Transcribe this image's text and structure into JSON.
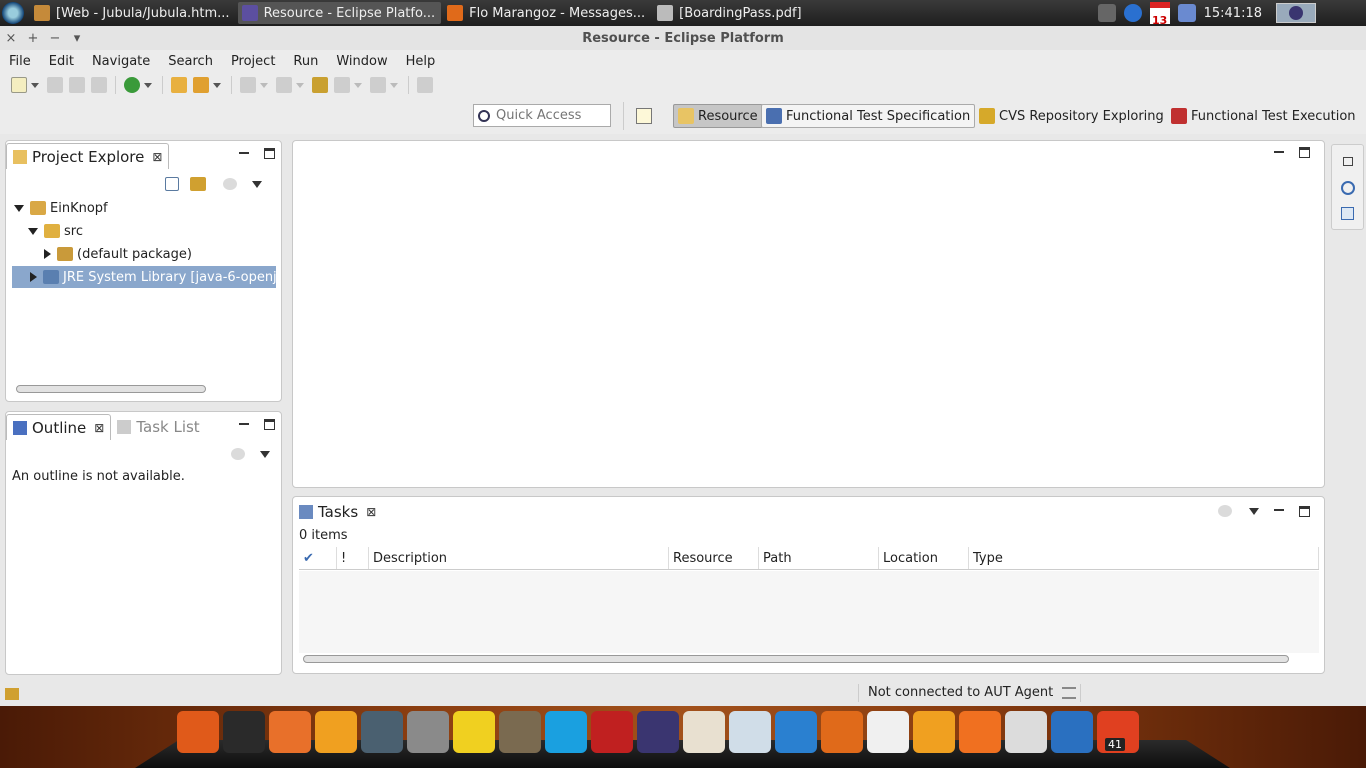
{
  "os_panel": {
    "tasks": [
      {
        "label": "[Web - Jubula/Jubula.htm...",
        "icon": "gear-icon",
        "color": "#c58a3a"
      },
      {
        "label": "Resource - Eclipse Platfo...",
        "icon": "eclipse-icon",
        "color": "#5c4fa0",
        "active": true
      },
      {
        "label": "Flo Marangoz - Messages...",
        "icon": "firefox-icon",
        "color": "#e06a1a"
      },
      {
        "label": "[BoardingPass.pdf]",
        "icon": "pdf-icon",
        "color": "#bbbbbb"
      }
    ],
    "calendar_month": "NOV",
    "calendar_day": "13",
    "clock": "15:41:18"
  },
  "window": {
    "title": "Resource - Eclipse Platform",
    "controls": [
      "×",
      "+",
      "−",
      "▾"
    ]
  },
  "menubar": [
    "File",
    "Edit",
    "Navigate",
    "Search",
    "Project",
    "Run",
    "Window",
    "Help"
  ],
  "quick_access": {
    "placeholder": "Quick Access"
  },
  "perspectives": [
    {
      "label": "Resource",
      "icon": "resource-folder-icon",
      "color": "#e8c464",
      "active": true
    },
    {
      "label": "Functional Test Specification",
      "icon": "test-spec-icon",
      "color": "#4a6fb0"
    },
    {
      "label": "CVS Repository Exploring",
      "icon": "cvs-icon",
      "color": "#d6a92a"
    },
    {
      "label": "Functional Test Execution",
      "icon": "test-execution-icon",
      "color": "#c03030"
    }
  ],
  "project_explorer": {
    "tab_label": "Project Explore",
    "tree": [
      {
        "label": "EinKnopf",
        "level": 0,
        "state": "open",
        "icon": "project-icon",
        "color": "#d9a845"
      },
      {
        "label": "src",
        "level": 1,
        "state": "open",
        "icon": "source-folder-icon",
        "color": "#e0b040"
      },
      {
        "label": "(default package)",
        "level": 2,
        "state": "closed",
        "icon": "package-icon",
        "color": "#c99a3a"
      },
      {
        "label": "JRE System Library [java-6-openj",
        "level": 1,
        "state": "closed",
        "icon": "library-icon",
        "color": "#5a7fb0",
        "selected": true
      }
    ]
  },
  "outline": {
    "tab_label": "Outline",
    "task_list_label": "Task List",
    "message": "An outline is not available."
  },
  "tasks": {
    "tab_label": "Tasks",
    "count": "0 items",
    "columns": [
      "✔",
      "!",
      "Description",
      "Resource",
      "Path",
      "Location",
      "Type"
    ]
  },
  "status": {
    "message": "Not connected to AUT Agent"
  },
  "dock": [
    {
      "name": "ubuntu-icon",
      "color": "#e05a1a"
    },
    {
      "name": "terminal-icon",
      "color": "#2a2a2a"
    },
    {
      "name": "shopping-bag-icon",
      "color": "#e8702a"
    },
    {
      "name": "settings-icon",
      "color": "#f0a020"
    },
    {
      "name": "owl-icon",
      "color": "#4a6070"
    },
    {
      "name": "calculator-icon",
      "color": "#8a8a8a"
    },
    {
      "name": "teapot-icon",
      "color": "#f0d020"
    },
    {
      "name": "gimp-icon",
      "color": "#7a6a50"
    },
    {
      "name": "skype-icon",
      "color": "#1aa0e0"
    },
    {
      "name": "color-blocks-icon",
      "color": "#c02020"
    },
    {
      "name": "eclipse-icon",
      "color": "#3a3570"
    },
    {
      "name": "presentation-icon",
      "color": "#e8e0d0"
    },
    {
      "name": "document-icon",
      "color": "#d0dde8"
    },
    {
      "name": "dropbox-icon",
      "color": "#2a80d0"
    },
    {
      "name": "firefox-icon",
      "color": "#e06a1a"
    },
    {
      "name": "files-icon",
      "color": "#f0f0f0"
    },
    {
      "name": "settings-icon",
      "color": "#f0a020"
    },
    {
      "name": "home-folder-icon",
      "color": "#f07020"
    },
    {
      "name": "archive-icon",
      "color": "#dcdcdc"
    },
    {
      "name": "accessibility-icon",
      "color": "#2a70c0"
    },
    {
      "name": "update-manager-icon",
      "color": "#e04020",
      "badge": "41"
    }
  ]
}
